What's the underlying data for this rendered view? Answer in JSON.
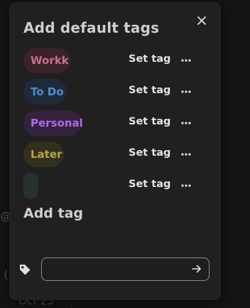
{
  "background": {
    "fragment_a": "k@",
    "fragment_b": "k (",
    "fragment_c": "Oct 23"
  },
  "dialog": {
    "title": "Add default tags",
    "close_icon": "close-icon",
    "set_tag_label": "Set tag",
    "more_icon": "more-horizontal-icon",
    "tags": [
      {
        "label": "Workk",
        "text_color": "#c46f8e",
        "bg_color": "#3a2228"
      },
      {
        "label": "To Do",
        "text_color": "#4f8fcf",
        "bg_color": "#1e2a3a"
      },
      {
        "label": "Personal",
        "text_color": "#b06ae0",
        "bg_color": "#34223f"
      },
      {
        "label": "Later",
        "text_color": "#b9a53e",
        "bg_color": "#332f1d"
      },
      {
        "label": "",
        "text_color": "#7aa08e",
        "bg_color": "#263230"
      }
    ],
    "add_tag": {
      "heading": "Add tag",
      "tag_icon": "tag-icon",
      "input_value": "",
      "input_placeholder": "",
      "submit_icon": "arrow-right-icon"
    }
  }
}
